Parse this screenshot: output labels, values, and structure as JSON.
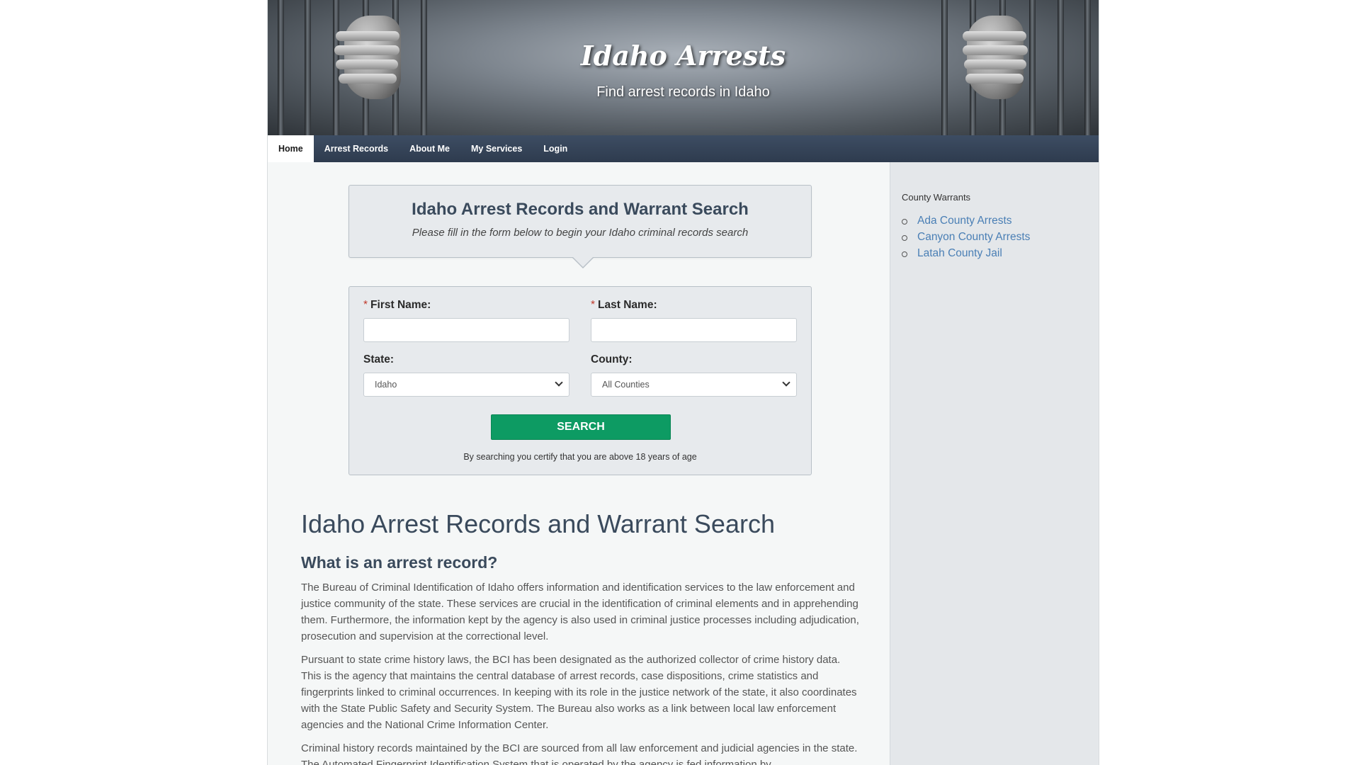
{
  "banner": {
    "title": "Idaho Arrests",
    "subtitle": "Find arrest records in Idaho"
  },
  "nav": {
    "items": [
      {
        "label": "Home",
        "active": true
      },
      {
        "label": "Arrest Records",
        "active": false
      },
      {
        "label": "About Me",
        "active": false
      },
      {
        "label": "My Services",
        "active": false
      },
      {
        "label": "Login",
        "active": false
      }
    ]
  },
  "search_header": {
    "title": "Idaho Arrest Records and Warrant Search",
    "subtitle": "Please fill in the form below to begin your Idaho criminal records search"
  },
  "form": {
    "required_marker": "*",
    "first_name_label": "First Name:",
    "first_name_value": "",
    "last_name_label": "Last Name:",
    "last_name_value": "",
    "state_label": "State:",
    "state_value": "Idaho",
    "county_label": "County:",
    "county_value": "All Counties",
    "search_button": "SEARCH",
    "certification": "By searching you certify that you are above 18 years of age"
  },
  "sidebar": {
    "heading": "County Warrants",
    "links": [
      "Ada County Arrests",
      "Canyon County Arrests",
      "Latah County Jail"
    ]
  },
  "article": {
    "heading": "Idaho Arrest Records and Warrant Search",
    "subheading": "What is an arrest record?",
    "paragraphs": [
      "The Bureau of Criminal Identification of Idaho offers information and identification services to the law enforcement and justice community of the state. These services are crucial in the identification of criminal elements and in apprehending them. Furthermore, the information kept by the agency is also used in criminal justice processes including adjudication, prosecution and supervision at the correctional level.",
      "Pursuant to state crime history laws, the BCI has been designated as the authorized collector of crime history data. This is the agency that maintains the central database of arrest records, case dispositions, crime statistics and fingerprints linked to criminal occurrences. In keeping with its role in the justice network of the state, it also coordinates with the State Public Safety and Security System. The Bureau also works as a link between local law enforcement agencies and the National Crime Information Center.",
      "Criminal history records maintained by the BCI are sourced from all law enforcement and judicial agencies in the state. The Automated Fingerprint Identification System that is operated by the agency is fed information by"
    ]
  },
  "colors": {
    "nav_bg": "#2e3b4e",
    "button_green": "#0d9b63",
    "link_blue": "#4a7fb5",
    "heading_slate": "#3a4a5c"
  }
}
